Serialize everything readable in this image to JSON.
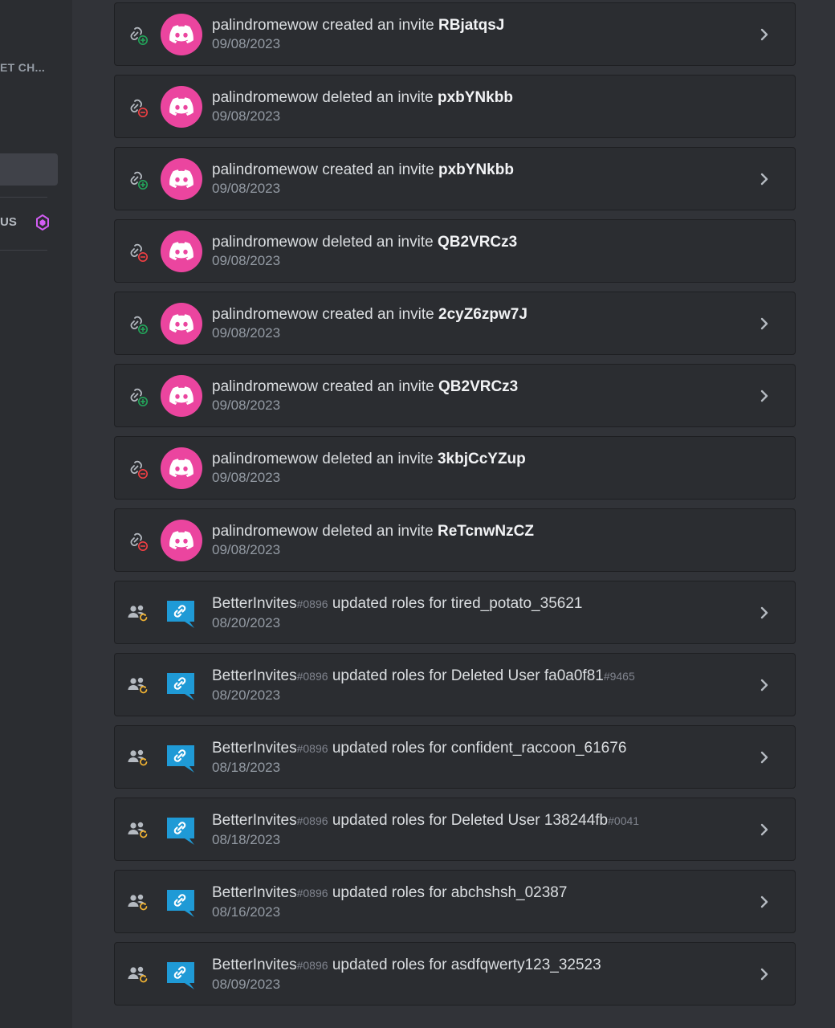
{
  "sidebar": {
    "heading": "ET CH...",
    "label": "US",
    "gem_color": "#d35df4"
  },
  "colors": {
    "avatar_pink": "#eb459f",
    "bot_blue": "#1f9ad6",
    "invite_add_green": "#23a55a",
    "invite_remove_red": "#f23f43",
    "role_update_orange": "#f0b232"
  },
  "entries": [
    {
      "icon": "invite-create-icon",
      "avatar": "discord",
      "user": "palindromewow",
      "action": "created an invite",
      "target": "RBjatqsJ",
      "date": "09/08/2023",
      "expandable": true
    },
    {
      "icon": "invite-delete-icon",
      "avatar": "discord",
      "user": "palindromewow",
      "action": "deleted an invite",
      "target": "pxbYNkbb",
      "date": "09/08/2023",
      "expandable": false
    },
    {
      "icon": "invite-create-icon",
      "avatar": "discord",
      "user": "palindromewow",
      "action": "created an invite",
      "target": "pxbYNkbb",
      "date": "09/08/2023",
      "expandable": true
    },
    {
      "icon": "invite-delete-icon",
      "avatar": "discord",
      "user": "palindromewow",
      "action": "deleted an invite",
      "target": "QB2VRCz3",
      "date": "09/08/2023",
      "expandable": false
    },
    {
      "icon": "invite-create-icon",
      "avatar": "discord",
      "user": "palindromewow",
      "action": "created an invite",
      "target": "2cyZ6zpw7J",
      "date": "09/08/2023",
      "expandable": true
    },
    {
      "icon": "invite-create-icon",
      "avatar": "discord",
      "user": "palindromewow",
      "action": "created an invite",
      "target": "QB2VRCz3",
      "date": "09/08/2023",
      "expandable": true
    },
    {
      "icon": "invite-delete-icon",
      "avatar": "discord",
      "user": "palindromewow",
      "action": "deleted an invite",
      "target": "3kbjCcYZup",
      "date": "09/08/2023",
      "expandable": false
    },
    {
      "icon": "invite-delete-icon",
      "avatar": "discord",
      "user": "palindromewow",
      "action": "deleted an invite",
      "target": "ReTcnwNzCZ",
      "date": "09/08/2023",
      "expandable": false
    },
    {
      "icon": "role-update-icon",
      "avatar": "bot",
      "user": "BetterInvites",
      "user_disc": "#0896",
      "action": "updated roles for",
      "target": "tired_potato_35621",
      "target_disc": "",
      "date": "08/20/2023",
      "expandable": true
    },
    {
      "icon": "role-update-icon",
      "avatar": "bot",
      "user": "BetterInvites",
      "user_disc": "#0896",
      "action": "updated roles for",
      "target": "Deleted User fa0a0f81",
      "target_disc": "#9465",
      "date": "08/20/2023",
      "expandable": true
    },
    {
      "icon": "role-update-icon",
      "avatar": "bot",
      "user": "BetterInvites",
      "user_disc": "#0896",
      "action": "updated roles for",
      "target": "confident_raccoon_61676",
      "target_disc": "",
      "date": "08/18/2023",
      "expandable": true
    },
    {
      "icon": "role-update-icon",
      "avatar": "bot",
      "user": "BetterInvites",
      "user_disc": "#0896",
      "action": "updated roles for",
      "target": "Deleted User 138244fb",
      "target_disc": "#0041",
      "date": "08/18/2023",
      "expandable": true
    },
    {
      "icon": "role-update-icon",
      "avatar": "bot",
      "user": "BetterInvites",
      "user_disc": "#0896",
      "action": "updated roles for",
      "target": "abchshsh_02387",
      "target_disc": "",
      "date": "08/16/2023",
      "expandable": true
    },
    {
      "icon": "role-update-icon",
      "avatar": "bot",
      "user": "BetterInvites",
      "user_disc": "#0896",
      "action": "updated roles for",
      "target": "asdfqwerty123_32523",
      "target_disc": "",
      "date": "08/09/2023",
      "expandable": true
    }
  ]
}
